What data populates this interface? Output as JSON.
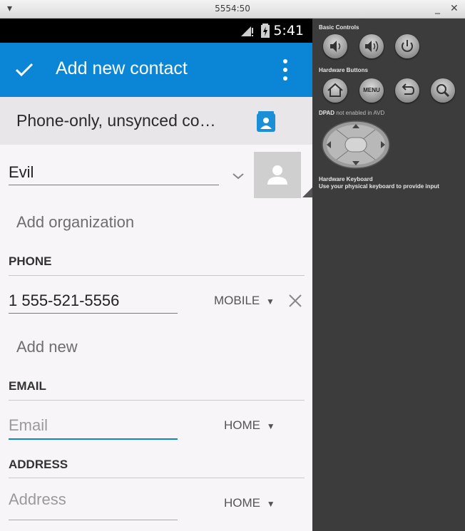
{
  "window": {
    "title": "5554:50"
  },
  "status_bar": {
    "time": "5:41"
  },
  "app_bar": {
    "title": "Add new contact"
  },
  "account": {
    "label": "Phone-only, unsynced co…"
  },
  "name": {
    "value": "Evil"
  },
  "organization": {
    "placeholder": "Add organization"
  },
  "phone": {
    "header": "PHONE",
    "number": "1 555-521-5556",
    "type": "MOBILE",
    "add_new": "Add new"
  },
  "email": {
    "header": "EMAIL",
    "placeholder": "Email",
    "type": "HOME"
  },
  "address": {
    "header": "ADDRESS",
    "placeholder": "Address",
    "type": "HOME"
  },
  "controls_panel": {
    "basic_controls_label": "Basic Controls",
    "hardware_buttons_label": "Hardware Buttons",
    "menu_label": "MENU",
    "dpad_label": "DPAD",
    "dpad_note": "not enabled in AVD",
    "keyboard_label": "Hardware Keyboard",
    "keyboard_note": "Use your physical keyboard to provide input"
  },
  "colors": {
    "app_bar": "#0b86d6",
    "accent": "#0b86d6",
    "panel": "#3c3c3c"
  }
}
